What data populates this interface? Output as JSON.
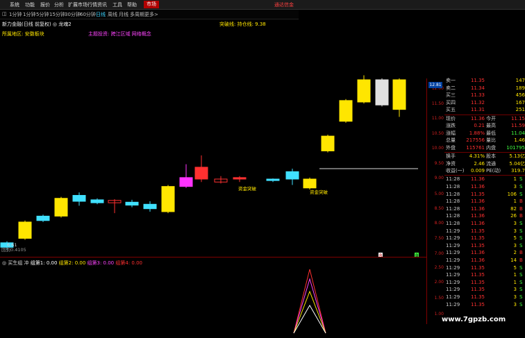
{
  "menu": {
    "items": [
      "系统",
      "功能",
      "报价",
      "分析",
      "扩展市场行情",
      "资讯",
      "工具",
      "帮助"
    ],
    "badge": "市场",
    "right_text": "通达信金"
  },
  "periods": {
    "items": [
      "1分钟",
      "1分钟",
      "5分钟",
      "15分钟",
      "30分钟",
      "60分钟",
      "日线",
      "周线",
      "月线",
      "多周期",
      "更多>"
    ],
    "active": "日线"
  },
  "chart": {
    "title": "新力金融(日线 前复权) ◎ 龙魂2",
    "indicator_label": "突破线: 持仓线: 9.38",
    "region_tag": "所属地区: 安徽板块",
    "theme_tag": "主题投资: 跨江区域 网络概念",
    "low_price_label": "6.61",
    "low_note": "回到0.4105",
    "annotations": [
      "资金突破",
      "资金突破"
    ],
    "current_price_tag": "12.81",
    "marker_labels": [
      "R",
      "B"
    ]
  },
  "sub_indicator": {
    "name": "◎ 买生组 冲",
    "lines": [
      {
        "label": "组第1: 0.00",
        "color": "#ffffff"
      },
      {
        "label": "组第2: 0.00",
        "color": "#ffe600"
      },
      {
        "label": "组第3: 0.00",
        "color": "#ff44ff"
      },
      {
        "label": "组第4: 0.00",
        "color": "#ff3030"
      }
    ]
  },
  "price_axis": [
    "12.00",
    "11.50",
    "11.00",
    "10.50",
    "10.00",
    "9.50",
    "9.00",
    "5.00",
    "8.50",
    "8.00",
    "7.50",
    "7.00"
  ],
  "sub_axis": [
    "2.50",
    "2.00",
    "1.50",
    "1.00"
  ],
  "quote": {
    "asks": [
      {
        "label": "卖一",
        "price": "11.35",
        "vol": "147"
      },
      {
        "label": "卖二",
        "price": "11.34",
        "vol": "189"
      },
      {
        "label": "买三",
        "price": "11.33",
        "vol": "456"
      },
      {
        "label": "买四",
        "price": "11.32",
        "vol": "167"
      },
      {
        "label": "买五",
        "price": "11.31",
        "vol": "251"
      }
    ],
    "stats": [
      {
        "l1": "现价",
        "v1": "11.36",
        "l2": "今开",
        "v2": "11.15"
      },
      {
        "l1": "涨跌",
        "v1": "0.21",
        "l2": "最高",
        "v2": "11.59"
      },
      {
        "l1": "涨幅",
        "v1": "1.88%",
        "l2": "最低",
        "v2": "11.04"
      },
      {
        "l1": "总量",
        "v1": "217556",
        "l2": "量比",
        "v2": "1.46"
      },
      {
        "l1": "外盘",
        "v1": "115761",
        "l2": "内盘",
        "v2": "101795"
      }
    ],
    "stats2": [
      {
        "l1": "换手",
        "v1": "4.31%",
        "l2": "股本",
        "v2": "5.13亿"
      },
      {
        "l1": "净资",
        "v1": "2.46",
        "l2": "流通",
        "v2": "5.04亿"
      },
      {
        "l1": "收益(一)",
        "v1": "0.009",
        "l2": "PE(动)",
        "v2": "319.7"
      }
    ],
    "ticks": [
      {
        "time": "11:28",
        "price": "11.36",
        "vol": "1",
        "side": "S"
      },
      {
        "time": "11:28",
        "price": "11.36",
        "vol": "3",
        "side": "S"
      },
      {
        "time": "11:28",
        "price": "11.35",
        "vol": "106",
        "side": "S"
      },
      {
        "time": "11:28",
        "price": "11.36",
        "vol": "1",
        "side": "B"
      },
      {
        "time": "11:28",
        "price": "11.36",
        "vol": "82",
        "side": "B"
      },
      {
        "time": "11:28",
        "price": "11.36",
        "vol": "26",
        "side": "B"
      },
      {
        "time": "11:28",
        "price": "11.36",
        "vol": "3",
        "side": "S"
      },
      {
        "time": "11:29",
        "price": "11.35",
        "vol": "3",
        "side": "S"
      },
      {
        "time": "11:29",
        "price": "11.35",
        "vol": "5",
        "side": "S"
      },
      {
        "time": "11:29",
        "price": "11.35",
        "vol": "3",
        "side": "S"
      },
      {
        "time": "11:29",
        "price": "11.36",
        "vol": "2",
        "side": "B"
      },
      {
        "time": "11:29",
        "price": "11.36",
        "vol": "14",
        "side": "B"
      },
      {
        "time": "11:29",
        "price": "11.35",
        "vol": "5",
        "side": "S"
      },
      {
        "time": "11:29",
        "price": "11.35",
        "vol": "1",
        "side": "S"
      },
      {
        "time": "11:29",
        "price": "11.35",
        "vol": "1",
        "side": "S"
      },
      {
        "time": "11:29",
        "price": "11.35",
        "vol": "3",
        "side": "S"
      },
      {
        "time": "11:29",
        "price": "11.35",
        "vol": "3",
        "side": "S"
      },
      {
        "time": "11:29",
        "price": "11.35",
        "vol": "3",
        "side": "S"
      }
    ]
  },
  "candles": [
    {
      "o": 6.7,
      "c": 6.85,
      "h": 6.9,
      "l": 6.61,
      "color": "#40e0ff"
    },
    {
      "o": 7.0,
      "c": 7.55,
      "h": 7.6,
      "l": 6.95,
      "color": "#ffe600"
    },
    {
      "o": 7.6,
      "c": 7.75,
      "h": 7.8,
      "l": 7.55,
      "color": "#40e0ff"
    },
    {
      "o": 7.75,
      "c": 8.35,
      "h": 8.4,
      "l": 7.7,
      "color": "#ffe600"
    },
    {
      "o": 8.25,
      "c": 8.45,
      "h": 8.55,
      "l": 8.1,
      "color": "#40e0ff"
    },
    {
      "o": 8.2,
      "c": 8.3,
      "h": 8.35,
      "l": 8.15,
      "color": "#40e0ff"
    },
    {
      "o": 8.2,
      "c": 8.28,
      "h": 8.32,
      "l": 7.85,
      "color": "#ff3030",
      "hollow": true
    },
    {
      "o": 8.12,
      "c": 8.22,
      "h": 8.3,
      "l": 8.05,
      "color": "#40e0ff"
    },
    {
      "o": 8.0,
      "c": 8.15,
      "h": 8.25,
      "l": 7.9,
      "color": "#40e0ff"
    },
    {
      "o": 7.9,
      "c": 8.75,
      "h": 8.8,
      "l": 7.85,
      "color": "#ffe600"
    },
    {
      "o": 8.75,
      "c": 9.05,
      "h": 9.5,
      "l": 8.7,
      "color": "#ff33ff"
    },
    {
      "o": 9.0,
      "c": 9.4,
      "h": 9.8,
      "l": 8.9,
      "color": "#ff3030"
    },
    {
      "o": 9.0,
      "c": 8.9,
      "h": 9.1,
      "l": 8.85,
      "color": "#ff3030",
      "hollow": true
    },
    {
      "o": 9.0,
      "c": 9.05,
      "h": 9.1,
      "l": 8.9,
      "color": "#ff3030"
    },
    {
      "o": 8.95,
      "c": 9.0,
      "h": 9.02,
      "l": 8.9,
      "color": "#40e0ff"
    },
    {
      "o": 9.0,
      "c": 9.25,
      "h": 9.35,
      "l": 8.8,
      "color": "#40e0ff"
    },
    {
      "o": 8.7,
      "c": 9.0,
      "h": 9.05,
      "l": 8.65,
      "color": "#ffe600"
    },
    {
      "o": 9.95,
      "c": 10.45,
      "h": 10.5,
      "l": 9.9,
      "color": "#ffe600"
    },
    {
      "o": 10.95,
      "c": 11.65,
      "h": 11.7,
      "l": 10.9,
      "color": "#ffe600"
    },
    {
      "o": 11.6,
      "c": 12.35,
      "h": 12.5,
      "l": 11.55,
      "color": "#ffe600"
    },
    {
      "o": 11.5,
      "c": 12.35,
      "h": 12.4,
      "l": 11.45,
      "color": "#e0e0e0"
    },
    {
      "o": 11.35,
      "c": 12.35,
      "h": 12.4,
      "l": 11.1,
      "color": "#ffe600"
    }
  ]
}
